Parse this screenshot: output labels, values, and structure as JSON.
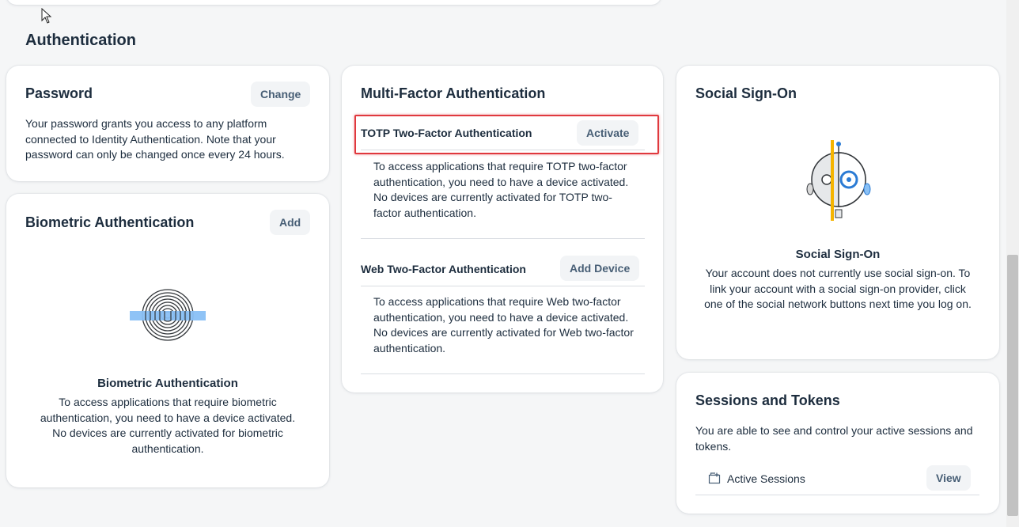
{
  "section": {
    "title": "Authentication"
  },
  "password": {
    "title": "Password",
    "button": "Change",
    "description": "Your password grants you access to any platform connected to Identity Authentication. Note that your password can only be changed once every 24 hours."
  },
  "biometric": {
    "title": "Biometric Authentication",
    "button": "Add",
    "empty_title": "Biometric Authentication",
    "empty_text": "To access applications that require biometric authentication, you need to have a device activated. No devices are currently activated for biometric authentication."
  },
  "mfa": {
    "title": "Multi-Factor Authentication",
    "totp": {
      "title": "TOTP Two-Factor Authentication",
      "button": "Activate",
      "text": "To access applications that require TOTP two-factor authentication, you need to have a device activated. No devices are currently activated for TOTP two-factor authentication."
    },
    "web": {
      "title": "Web Two-Factor Authentication",
      "button": "Add Device",
      "text": "To access applications that require Web two-factor authentication, you need to have a device activated. No devices are currently activated for Web two-factor authentication."
    }
  },
  "social": {
    "title": "Social Sign-On",
    "empty_title": "Social Sign-On",
    "empty_text": "Your account does not currently use social sign-on. To link your account with a social sign-on provider, click one of the social network buttons next time you log on."
  },
  "sessions": {
    "title": "Sessions and Tokens",
    "description": "You are able to see and control your active sessions and tokens.",
    "item_label": "Active Sessions",
    "item_icon": "sessions-icon",
    "button": "View"
  },
  "colors": {
    "highlight": "#e0393e",
    "fingerprint_bar": "#89c0f5",
    "robot_accent": "#f5b400"
  }
}
